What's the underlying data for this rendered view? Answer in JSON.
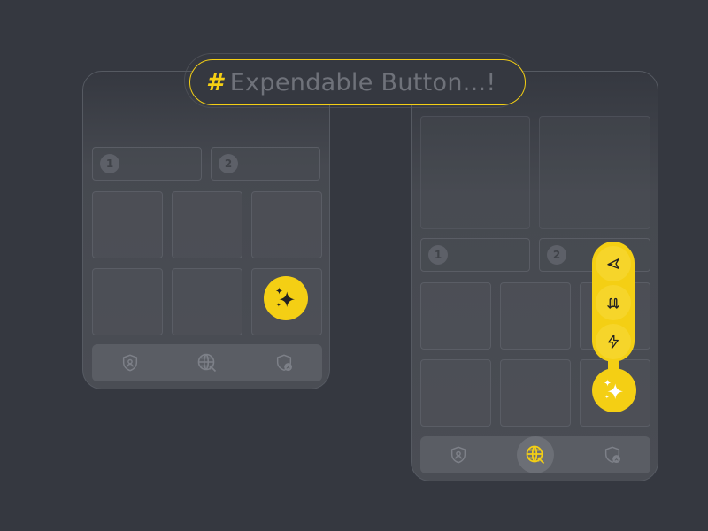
{
  "title": {
    "hash": "#",
    "text": "Expendable Button...!"
  },
  "accent_color": "#f4cf14",
  "left_phone": {
    "cards": [
      {
        "number": "1"
      },
      {
        "number": "2"
      }
    ],
    "fab": {
      "icon": "sparkles-icon",
      "state": "collapsed"
    },
    "nav": [
      {
        "icon": "shield-person-icon",
        "active": false
      },
      {
        "icon": "globe-cursor-icon",
        "active": false
      },
      {
        "icon": "shield-user-settings-icon",
        "active": false
      }
    ]
  },
  "right_phone": {
    "cards": [
      {
        "number": "1"
      },
      {
        "number": "2"
      }
    ],
    "fab": {
      "icon": "sparkles-icon",
      "state": "expanded"
    },
    "expanded_actions": [
      {
        "icon": "send-arrow-icon"
      },
      {
        "icon": "swap-arrows-icon"
      },
      {
        "icon": "lightning-icon"
      }
    ],
    "nav": [
      {
        "icon": "shield-person-icon",
        "active": false
      },
      {
        "icon": "globe-cursor-icon",
        "active": true
      },
      {
        "icon": "shield-user-settings-icon",
        "active": false
      }
    ]
  }
}
